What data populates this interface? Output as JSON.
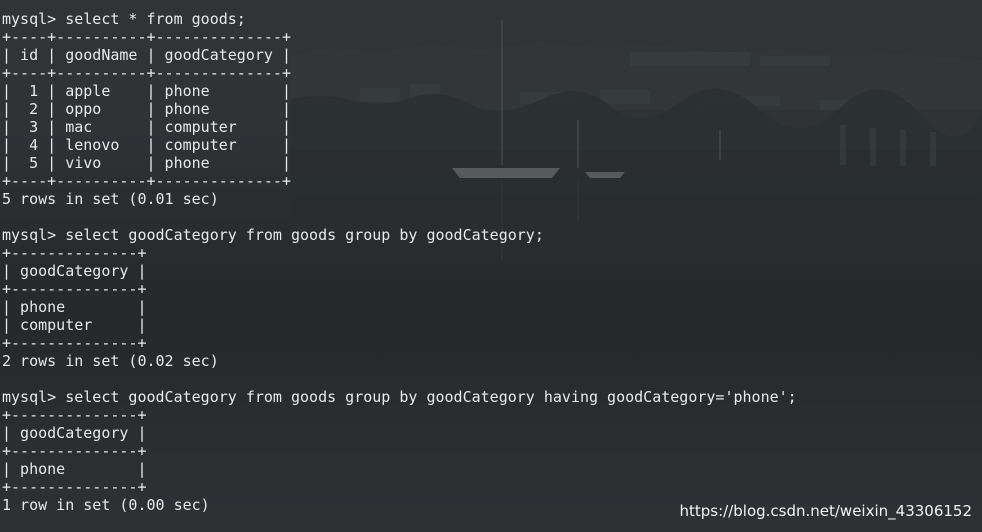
{
  "terminal": {
    "lines": [
      "mysql> select * from goods;",
      "+----+----------+--------------+",
      "| id | goodName | goodCategory |",
      "+----+----------+--------------+",
      "|  1 | apple    | phone        |",
      "|  2 | oppo     | phone        |",
      "|  3 | mac      | computer     |",
      "|  4 | lenovo   | computer     |",
      "|  5 | vivo     | phone        |",
      "+----+----------+--------------+",
      "5 rows in set (0.01 sec)",
      "",
      "mysql> select goodCategory from goods group by goodCategory;",
      "+--------------+",
      "| goodCategory |",
      "+--------------+",
      "| phone        |",
      "| computer     |",
      "+--------------+",
      "2 rows in set (0.02 sec)",
      "",
      "mysql> select goodCategory from goods group by goodCategory having goodCategory='phone';",
      "+--------------+",
      "| goodCategory |",
      "+--------------+",
      "| phone        |",
      "+--------------+",
      "1 row in set (0.00 sec)"
    ]
  },
  "watermark": "https://blog.csdn.net/weixin_43306152"
}
